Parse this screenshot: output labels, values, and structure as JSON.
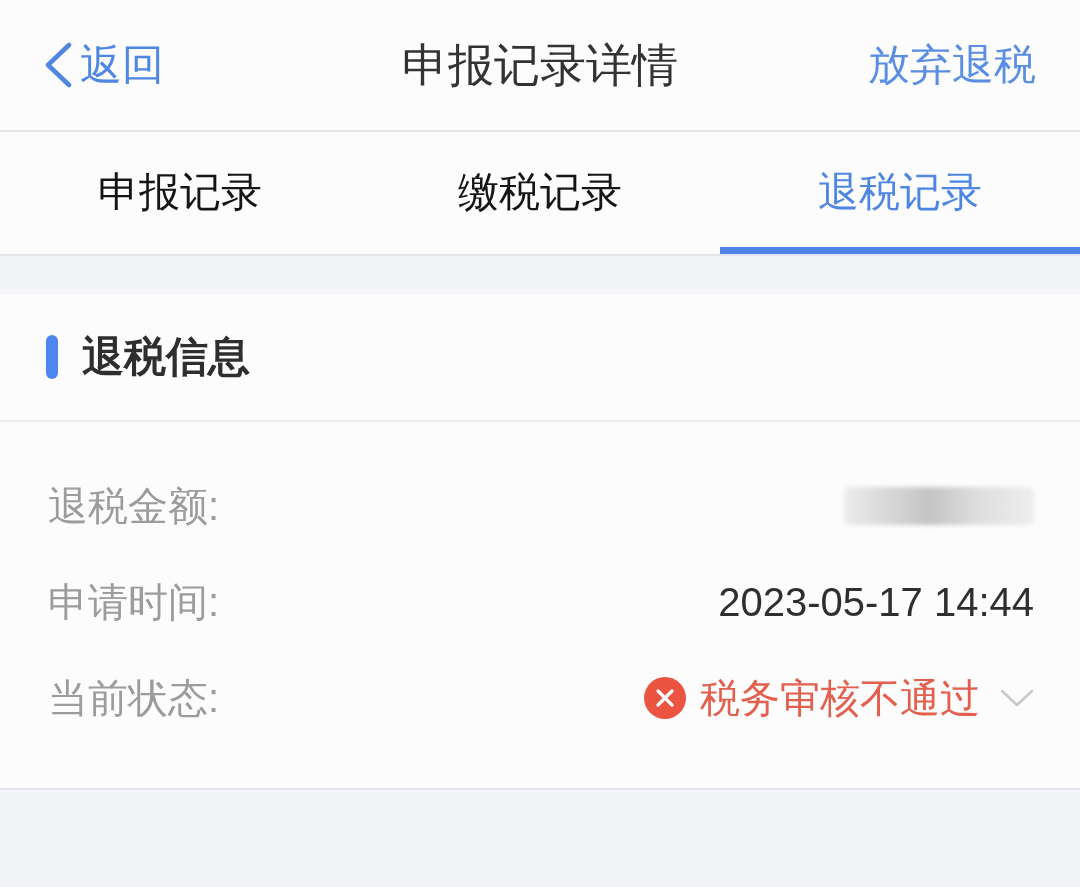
{
  "header": {
    "back": "返回",
    "title": "申报记录详情",
    "action": "放弃退税"
  },
  "tabs": [
    {
      "label": "申报记录",
      "selected": false
    },
    {
      "label": "缴税记录",
      "selected": false
    },
    {
      "label": "退税记录",
      "selected": true
    }
  ],
  "section": {
    "title": "退税信息"
  },
  "fields": [
    {
      "kind": "redacted",
      "label": "退税金额:"
    },
    {
      "kind": "text",
      "label": "申请时间:",
      "value": "2023-05-17 14:44"
    },
    {
      "kind": "status",
      "label": "当前状态:",
      "value": "税务审核不通过",
      "expanded": false
    }
  ]
}
